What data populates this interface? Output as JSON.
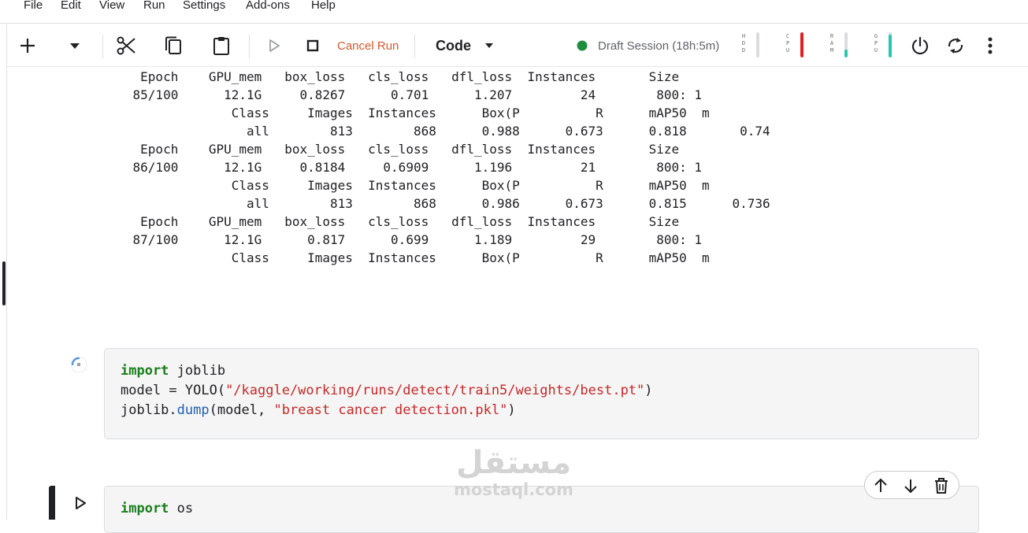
{
  "menu": [
    "File",
    "Edit",
    "View",
    "Run",
    "Settings",
    "Add-ons",
    "Help"
  ],
  "toolbar": {
    "add_icon": "plus-icon",
    "cancel_run_label": "Cancel Run",
    "cell_type": "Code",
    "session_label": "Draft Session (18h:5m)",
    "session_status_color": "#1e8e3e",
    "meters": [
      {
        "name": "HDD",
        "level": 0.0,
        "color": "#dadce0"
      },
      {
        "name": "CPU",
        "level": 1.0,
        "color": "#e02020"
      },
      {
        "name": "RAM",
        "level": 0.3,
        "color": "#26c6b0"
      },
      {
        "name": "GPU",
        "level": 0.9,
        "color": "#26c6b0"
      }
    ]
  },
  "output": {
    "lines": [
      "     Epoch    GPU_mem   box_loss   cls_loss   dfl_loss  Instances       Size",
      "    85/100      12.1G     0.8267      0.701      1.207         24        800: 1",
      "                 Class     Images  Instances      Box(P          R      mAP50  m",
      "                   all        813        868      0.988      0.673      0.818       0.74",
      "",
      "     Epoch    GPU_mem   box_loss   cls_loss   dfl_loss  Instances       Size",
      "    86/100      12.1G     0.8184     0.6909      1.196         21        800: 1",
      "                 Class     Images  Instances      Box(P          R      mAP50  m",
      "                   all        813        868      0.986      0.673      0.815      0.736",
      "",
      "     Epoch    GPU_mem   box_loss   cls_loss   dfl_loss  Instances       Size",
      "    87/100      12.1G      0.817      0.699      1.189         29        800: 1",
      "                 Class     Images  Instances      Box(P          R      mAP50  m"
    ]
  },
  "cells": [
    {
      "line1": {
        "kw": "import",
        "rest": " joblib"
      },
      "line2": {
        "pre": "model = YOLO(",
        "str": "\"/kaggle/working/runs/detect/train5/weights/best.pt\"",
        "post": ")"
      },
      "line3": {
        "pre": "joblib.",
        "attr": "dump",
        "mid": "(model, ",
        "str": "\"breast cancer detection.pkl\"",
        "post": ")"
      }
    },
    {
      "line1": {
        "kw": "import",
        "rest": " os"
      }
    }
  ],
  "watermark": {
    "arabic": "مستقل",
    "latin": "mostaql.com"
  }
}
